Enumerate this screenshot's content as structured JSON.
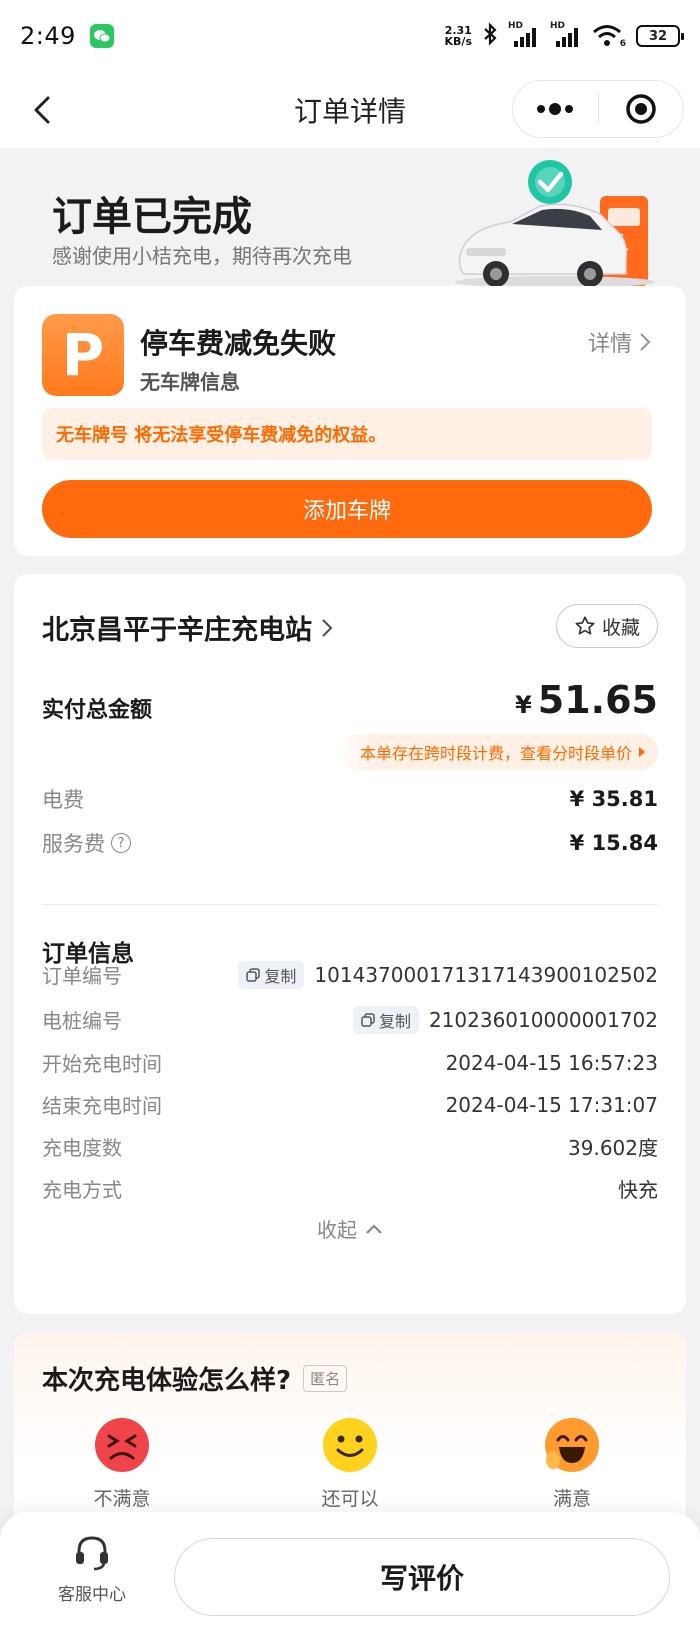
{
  "status_bar": {
    "time": "2:49",
    "net_speed_value": "2.31",
    "net_speed_unit": "KB/s",
    "signal_tag_1": "HD",
    "signal_tag_2": "HD",
    "wifi_tag": "6",
    "battery": "32"
  },
  "nav": {
    "title": "订单详情"
  },
  "hero": {
    "title": "订单已完成",
    "subtitle": "感谢使用小桔充电，期待再次充电"
  },
  "parking": {
    "icon_letter": "P",
    "title": "停车费减免失败",
    "subtitle": "无车牌信息",
    "detail_link": "详情",
    "warning": "无车牌号 将无法享受停车费减免的权益。",
    "add_plate_button": "添加车牌"
  },
  "station": {
    "name": "北京昌平于辛庄充电站",
    "favorite_label": "收藏",
    "total_label": "实付总金额",
    "currency": "¥",
    "total_amount": "51.65",
    "tiered_notice": "本单存在跨时段计费，查看分时段单价",
    "fees": [
      {
        "label": "电费",
        "value": "¥ 35.81"
      },
      {
        "label": "服务费",
        "value": "¥ 15.84"
      }
    ],
    "info_title": "订单信息",
    "copy_label": "复制",
    "info_rows": [
      {
        "label": "订单编号",
        "value": "1014370001713171439001025 02"
      },
      {
        "label": "电桩编号",
        "value": "210236010000001702"
      },
      {
        "label": "开始充电时间",
        "value": "2024-04-15 16:57:23"
      },
      {
        "label": "结束充电时间",
        "value": "2024-04-15 17:31:07"
      },
      {
        "label": "充电度数",
        "value": "39.602度"
      },
      {
        "label": "充电方式",
        "value": "快充"
      }
    ],
    "collapse_label": "收起"
  },
  "rating": {
    "title": "本次充电体验怎么样?",
    "anonymous_tag": "匿名",
    "options": [
      {
        "label": "不满意",
        "color": "#f0434a"
      },
      {
        "label": "还可以",
        "color": "#ffd21f"
      },
      {
        "label": "满意",
        "color": "#ff9a2e"
      }
    ]
  },
  "bottom": {
    "customer_service_label": "客服中心",
    "write_review_button": "写评价"
  },
  "colors": {
    "accent": "#ff6a0e",
    "warning_text": "#ff6a00",
    "warning_bg": "#fff0e6"
  }
}
